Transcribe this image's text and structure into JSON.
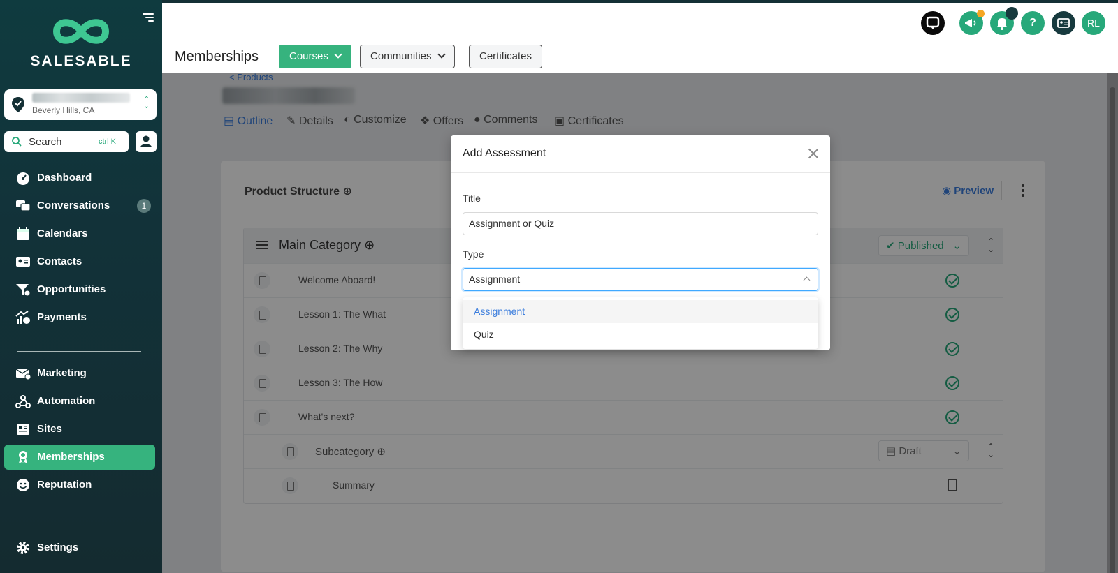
{
  "sidebar": {
    "brand": "SALESABLE",
    "location_city": "Beverly Hills, CA",
    "search_label": "Search",
    "search_shortcut": "ctrl K",
    "items": [
      {
        "label": "Dashboard",
        "icon": "dashboard-icon"
      },
      {
        "label": "Conversations",
        "icon": "chat-icon",
        "badge": "1"
      },
      {
        "label": "Calendars",
        "icon": "calendar-icon"
      },
      {
        "label": "Contacts",
        "icon": "contact-card-icon"
      },
      {
        "label": "Opportunities",
        "icon": "funnel-icon"
      },
      {
        "label": "Payments",
        "icon": "payments-icon"
      },
      {
        "label": "Marketing",
        "icon": "envelope-icon"
      },
      {
        "label": "Automation",
        "icon": "webhook-icon"
      },
      {
        "label": "Sites",
        "icon": "sites-icon"
      },
      {
        "label": "Memberships",
        "icon": "award-icon",
        "active": true
      },
      {
        "label": "Reputation",
        "icon": "smiley-icon"
      },
      {
        "label": "Settings",
        "icon": "gear-icon"
      }
    ]
  },
  "topbar": {
    "avatar_initials": "RL",
    "help_label": "?"
  },
  "subbar": {
    "title": "Memberships",
    "courses": "Courses",
    "communities": "Communities",
    "certificates": "Certificates"
  },
  "content": {
    "breadcrumb": "< Products",
    "tabs": [
      "Outline",
      "Details",
      "Customize",
      "Offers",
      "Comments",
      "Certificates"
    ],
    "product_structure": "Product Structure",
    "preview": "Preview",
    "main_category": "Main Category",
    "published": "Published",
    "lessons": [
      "Welcome Aboard!",
      "Lesson 1: The What",
      "Lesson 2: The Why",
      "Lesson 3: The How",
      "What's next?"
    ],
    "subcategory": "Subcategory",
    "draft": "Draft",
    "summary": "Summary"
  },
  "modal": {
    "title": "Add Assessment",
    "title_label": "Title",
    "title_placeholder": "Assignment or Quiz",
    "type_label": "Type",
    "type_value": "Assignment",
    "options": [
      "Assignment",
      "Quiz"
    ]
  },
  "colors": {
    "accent": "#36b37e",
    "sidebar_bg": "#123239",
    "link": "#3b7ddd"
  }
}
